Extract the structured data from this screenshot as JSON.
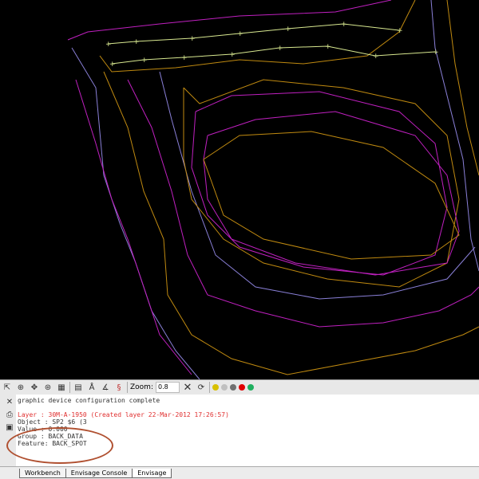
{
  "toolbar": {
    "zoom_label": "Zoom:",
    "zoom_value": "0.8",
    "icons": [
      "select-icon",
      "pan-icon",
      "move-icon",
      "zoom-extent-icon",
      "grid-icon",
      "plot-icon",
      "north-arrow-icon",
      "angle-icon",
      "contour-icon",
      "clear-icon",
      "refresh-icon"
    ],
    "status_dots": [
      "#d8c000",
      "#c0c0c0",
      "#707070",
      "#e00000",
      "#20b060"
    ]
  },
  "console": {
    "lines": [
      {
        "text": "graphic device configuration complete",
        "color": "#333333"
      },
      {
        "text": "Layer   : 30M-A-1950 (Created layer 22-Mar-2012 17:26:57)",
        "color": "#e03030"
      },
      {
        "text": "Object  : SP2 $6 (3",
        "color": "#333333"
      },
      {
        "text": "Value   :              0.000",
        "color": "#333333"
      },
      {
        "text": "Group   : BACK_DATA",
        "color": "#333333"
      },
      {
        "text": "Feature: BACK_SPOT",
        "color": "#333333"
      }
    ]
  },
  "tabs": [
    "Workbench",
    "Envisage Console",
    "Envisage"
  ],
  "colors": {
    "magenta": "#c020c0",
    "orange": "#c08a10",
    "lavender": "#8a80d8",
    "survey": "#d8e890"
  }
}
